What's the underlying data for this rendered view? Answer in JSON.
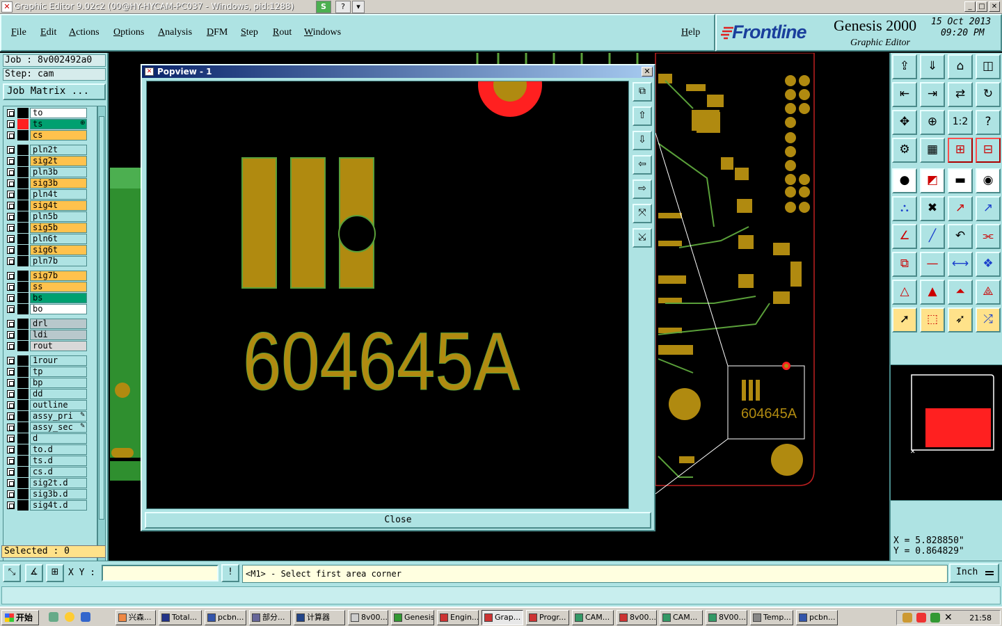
{
  "window": {
    "title": "Graphic Editor 9.02c2 (00@HY-HYCAM-PC037 - Windows, pid:1288)",
    "extra_buttons": [
      "S",
      "?",
      "▾"
    ],
    "controls": [
      "_",
      "□",
      "✕"
    ]
  },
  "menu": {
    "items": [
      "File",
      "Edit",
      "Actions",
      "Options",
      "Analysis",
      "DFM",
      "Step",
      "Rout",
      "Windows"
    ],
    "help": "Help"
  },
  "brand": {
    "logo": "Frontline",
    "product": "Genesis 2000",
    "subtitle": "Graphic Editor",
    "date": "15 Oct 2013",
    "time": "09:20 PM"
  },
  "job": {
    "job_line": "Job : 8v002492a0",
    "step_line": "Step: cam",
    "matrix_button": "Job Matrix ..."
  },
  "layers": [
    {
      "name": "to",
      "swatch": "#000000",
      "bg": "#ffffff"
    },
    {
      "name": "ts",
      "swatch": "#ff2020",
      "bg": "#00a070",
      "mark": "⊕",
      "active": true
    },
    {
      "name": "cs",
      "swatch": "#000000",
      "bg": "#ffc24d"
    },
    {
      "name": "pln2t",
      "swatch": "#000000",
      "bg": "#aee3e3",
      "gap": true
    },
    {
      "name": "sig2t",
      "swatch": "#000000",
      "bg": "#ffc24d"
    },
    {
      "name": "pln3b",
      "swatch": "#000000",
      "bg": "#aee3e3"
    },
    {
      "name": "sig3b",
      "swatch": "#000000",
      "bg": "#ffc24d"
    },
    {
      "name": "pln4t",
      "swatch": "#000000",
      "bg": "#aee3e3"
    },
    {
      "name": "sig4t",
      "swatch": "#000000",
      "bg": "#ffc24d"
    },
    {
      "name": "pln5b",
      "swatch": "#000000",
      "bg": "#aee3e3"
    },
    {
      "name": "sig5b",
      "swatch": "#000000",
      "bg": "#ffc24d"
    },
    {
      "name": "pln6t",
      "swatch": "#000000",
      "bg": "#aee3e3"
    },
    {
      "name": "sig6t",
      "swatch": "#000000",
      "bg": "#ffc24d"
    },
    {
      "name": "pln7b",
      "swatch": "#000000",
      "bg": "#aee3e3"
    },
    {
      "name": "sig7b",
      "swatch": "#000000",
      "bg": "#ffc24d",
      "gap": true
    },
    {
      "name": "ss",
      "swatch": "#000000",
      "bg": "#ffc24d"
    },
    {
      "name": "bs",
      "swatch": "#000000",
      "bg": "#00a070"
    },
    {
      "name": "bo",
      "swatch": "#000000",
      "bg": "#ffffff"
    },
    {
      "name": "drl",
      "swatch": "#000000",
      "bg": "#b8c8cc",
      "gap": true
    },
    {
      "name": "ldi",
      "swatch": "#000000",
      "bg": "#b8c8cc"
    },
    {
      "name": "rout",
      "swatch": "#000000",
      "bg": "#d8d8d8"
    },
    {
      "name": "1rour",
      "swatch": "#000000",
      "bg": "#aee3e3",
      "gap": true
    },
    {
      "name": "tp",
      "swatch": "#000000",
      "bg": "#aee3e3"
    },
    {
      "name": "bp",
      "swatch": "#000000",
      "bg": "#aee3e3"
    },
    {
      "name": "dd",
      "swatch": "#000000",
      "bg": "#aee3e3"
    },
    {
      "name": "outline",
      "swatch": "#000000",
      "bg": "#aee3e3"
    },
    {
      "name": "assy_pri",
      "swatch": "#000000",
      "bg": "#aee3e3",
      "mark": "✎"
    },
    {
      "name": "assy_sec",
      "swatch": "#000000",
      "bg": "#aee3e3",
      "mark": "✎"
    },
    {
      "name": "d",
      "swatch": "#000000",
      "bg": "#aee3e3"
    },
    {
      "name": "to.d",
      "swatch": "#000000",
      "bg": "#aee3e3"
    },
    {
      "name": "ts.d",
      "swatch": "#000000",
      "bg": "#aee3e3"
    },
    {
      "name": "cs.d",
      "swatch": "#000000",
      "bg": "#aee3e3"
    },
    {
      "name": "sig2t.d",
      "swatch": "#000000",
      "bg": "#aee3e3"
    },
    {
      "name": "sig3b.d",
      "swatch": "#000000",
      "bg": "#aee3e3"
    },
    {
      "name": "sig4t.d",
      "swatch": "#000000",
      "bg": "#aee3e3"
    }
  ],
  "selected": "Selected : 0",
  "popview": {
    "title": "Popview - 1",
    "marking": "604645A",
    "close_label": "Close"
  },
  "board": {
    "marking": "604645A"
  },
  "coords": {
    "x_line": "X = 5.828850\"",
    "y_line": "Y = 0.864829\""
  },
  "command": {
    "xy_label": "X Y :",
    "xy_value": "",
    "info_button": "!",
    "prompt": "<M1> - Select first area corner",
    "units": "Inch"
  },
  "taskbar": {
    "start": "开始",
    "tasks": [
      "兴森...",
      "Total...",
      "pcbn...",
      "部分...",
      "计算器",
      "8v00...",
      "Genesis",
      "Engin...",
      "Grap...",
      "Progr...",
      "CAM...",
      "8v00...",
      "CAM...",
      "8V00...",
      "Temp...",
      "pcbn..."
    ],
    "clock": "21:58"
  },
  "colors": {
    "panel": "#aee3e3",
    "copper": "#b08a10",
    "silk": "#c9a21a",
    "trace": "#5aa03a",
    "highlight": "#ff2020"
  }
}
